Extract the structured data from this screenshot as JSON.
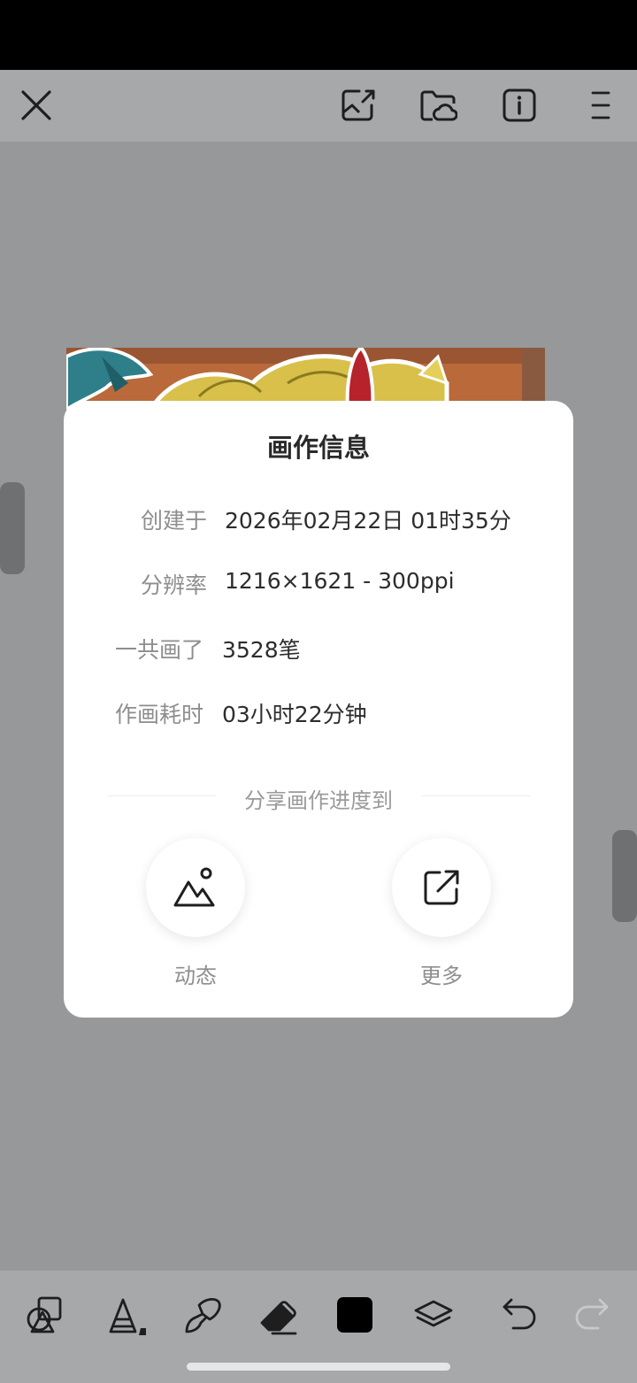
{
  "top_bar": {
    "icons": [
      "close-icon",
      "export-image-icon",
      "cloud-folder-icon",
      "info-icon",
      "menu-icon"
    ]
  },
  "dialog": {
    "title": "画作信息",
    "rows": [
      {
        "label": "创建于",
        "value": "2026年02月22日 01时35分"
      },
      {
        "label": "分辨率",
        "value": "1216×1621 - 300ppi"
      },
      {
        "label": "一共画了",
        "value": "3528笔"
      },
      {
        "label": "作画耗时",
        "value": "03小时22分钟"
      }
    ],
    "share_title": "分享画作进度到",
    "share_options": [
      {
        "label": "动态",
        "icon": "mountain-image-icon"
      },
      {
        "label": "更多",
        "icon": "external-share-icon"
      }
    ]
  },
  "bottom_toolbar": {
    "tools": [
      "shapes-icon",
      "brush-size-icon",
      "paint-brush-icon",
      "eraser-icon",
      "color-swatch",
      "layers-icon",
      "undo-icon",
      "redo-icon"
    ],
    "active_color": "#000000"
  }
}
